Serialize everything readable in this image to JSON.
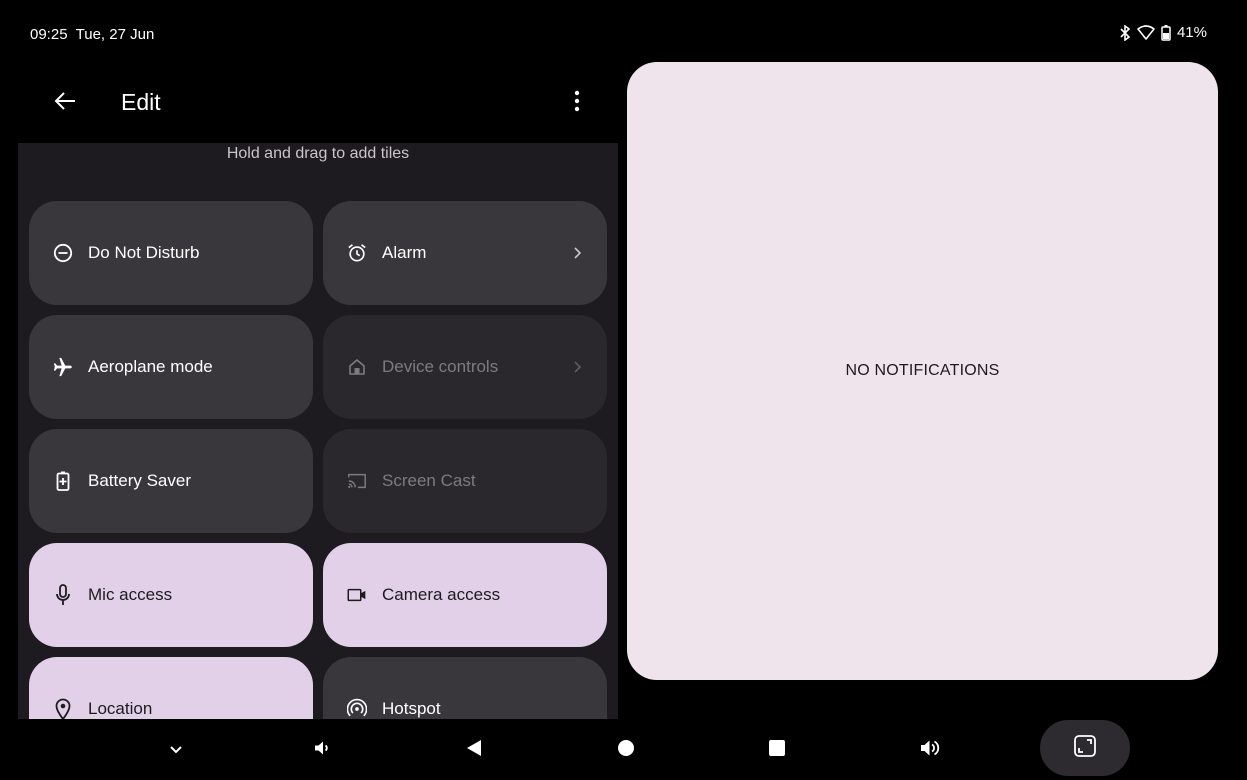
{
  "status_bar": {
    "time": "09:25",
    "date": "Tue, 27 Jun",
    "battery": "41%",
    "icons": [
      "bluetooth-icon",
      "wifi-icon",
      "battery-icon"
    ]
  },
  "header": {
    "title": "Edit",
    "back_icon": "arrow-left-icon",
    "more_icon": "more-vert-icon"
  },
  "tiles": {
    "hint": "Hold and drag to add tiles",
    "items": [
      {
        "label": "Do Not Disturb",
        "icon": "do-not-disturb-icon",
        "state": "off",
        "chevron": false
      },
      {
        "label": "Alarm",
        "icon": "alarm-icon",
        "state": "off",
        "chevron": true
      },
      {
        "label": "Aeroplane mode",
        "icon": "airplane-icon",
        "state": "off",
        "chevron": false
      },
      {
        "label": "Device controls",
        "icon": "home-icon",
        "state": "unavailable",
        "chevron": true
      },
      {
        "label": "Battery Saver",
        "icon": "battery-saver-icon",
        "state": "off",
        "chevron": false
      },
      {
        "label": "Screen Cast",
        "icon": "cast-icon",
        "state": "unavailable",
        "chevron": false
      },
      {
        "label": "Mic access",
        "icon": "mic-icon",
        "state": "on",
        "chevron": false
      },
      {
        "label": "Camera access",
        "icon": "camera-icon",
        "state": "on",
        "chevron": false
      },
      {
        "label": "Location",
        "icon": "location-icon",
        "state": "on",
        "chevron": false
      },
      {
        "label": "Hotspot",
        "icon": "hotspot-icon",
        "state": "off",
        "chevron": false
      }
    ]
  },
  "notifications": {
    "empty_text": "NO NOTIFICATIONS"
  },
  "nav_bar": {
    "buttons": [
      "collapse-chevron-icon",
      "volume-down-icon",
      "back-triangle-icon",
      "home-circle-icon",
      "recents-square-icon",
      "volume-up-icon",
      "screenshot-icon"
    ]
  },
  "colors": {
    "background": "#000000",
    "tile_off": "#3a373c",
    "tile_unavailable": "#2a282c",
    "tile_on": "#e1d0e8",
    "notification_card": "#f0e4ec",
    "panel": "#1d1b1f"
  }
}
